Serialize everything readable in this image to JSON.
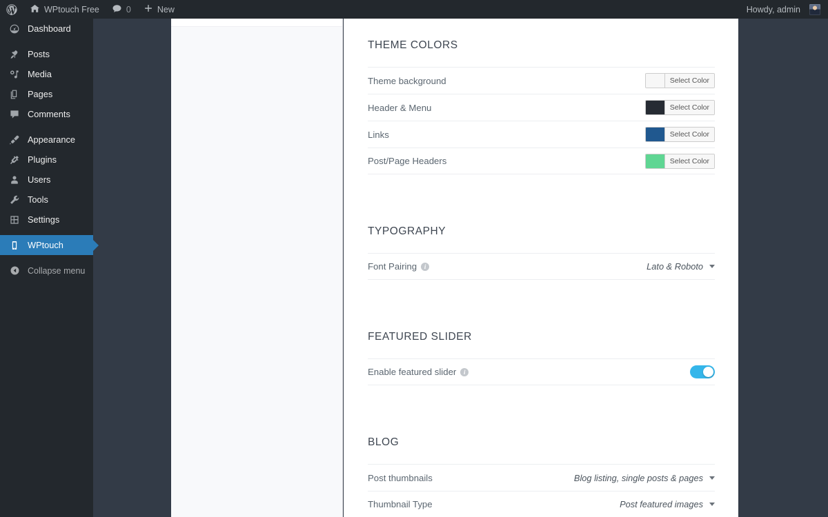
{
  "adminbar": {
    "logo_icon": "wordpress-logo-icon",
    "site_icon": "home-icon",
    "site_name": "WPtouch Free",
    "comments_icon": "comment-bubble-icon",
    "comments_count": "0",
    "new_icon": "plus-icon",
    "new_label": "New",
    "howdy": "Howdy, admin",
    "avatar_icon": "user-avatar"
  },
  "sidebar": {
    "items": [
      {
        "label": "Dashboard",
        "icon": "dashboard-gauge-icon",
        "current": false,
        "separated": false
      },
      {
        "label": "Posts",
        "icon": "pin-icon",
        "current": false,
        "separated": true
      },
      {
        "label": "Media",
        "icon": "media-icon",
        "current": false,
        "separated": false
      },
      {
        "label": "Pages",
        "icon": "pages-icon",
        "current": false,
        "separated": false
      },
      {
        "label": "Comments",
        "icon": "comment-bubble-icon",
        "current": false,
        "separated": false
      },
      {
        "label": "Appearance",
        "icon": "paintbrush-icon",
        "current": false,
        "separated": true
      },
      {
        "label": "Plugins",
        "icon": "plug-icon",
        "current": false,
        "separated": false
      },
      {
        "label": "Users",
        "icon": "user-icon",
        "current": false,
        "separated": false
      },
      {
        "label": "Tools",
        "icon": "wrench-icon",
        "current": false,
        "separated": false
      },
      {
        "label": "Settings",
        "icon": "sliders-icon",
        "current": false,
        "separated": false
      },
      {
        "label": "WPtouch",
        "icon": "smartphone-icon",
        "current": true,
        "separated": true
      }
    ],
    "collapse": {
      "label": "Collapse menu",
      "icon": "collapse-arrow-icon"
    }
  },
  "colors": {
    "accent_blue": "#2b7cb8",
    "adminbar_bg": "#23282d",
    "page_bg": "#333b47",
    "toggle_on": "#35b6ea"
  },
  "main": {
    "sections": [
      {
        "key": "theme_colors",
        "title": "THEME COLORS",
        "rows": [
          {
            "label": "Theme background",
            "type": "color",
            "swatch": "#f7f7f7",
            "button": "Select Color"
          },
          {
            "label": "Header & Menu",
            "type": "color",
            "swatch": "#262b33",
            "button": "Select Color"
          },
          {
            "label": "Links",
            "type": "color",
            "swatch": "#20588f",
            "button": "Select Color"
          },
          {
            "label": "Post/Page Headers",
            "type": "color",
            "swatch": "#5fd693",
            "button": "Select Color"
          }
        ]
      },
      {
        "key": "typography",
        "title": "TYPOGRAPHY",
        "rows": [
          {
            "label": "Font Pairing",
            "info": true,
            "type": "select",
            "value": "Lato & Roboto"
          }
        ]
      },
      {
        "key": "featured_slider",
        "title": "FEATURED SLIDER",
        "rows": [
          {
            "label": "Enable featured slider",
            "info": true,
            "type": "toggle",
            "value": "on"
          }
        ]
      },
      {
        "key": "blog",
        "title": "BLOG",
        "rows": [
          {
            "label": "Post thumbnails",
            "type": "select",
            "value": "Blog listing, single posts & pages"
          },
          {
            "label": "Thumbnail Type",
            "type": "select",
            "value": "Post featured images"
          }
        ]
      }
    ]
  }
}
